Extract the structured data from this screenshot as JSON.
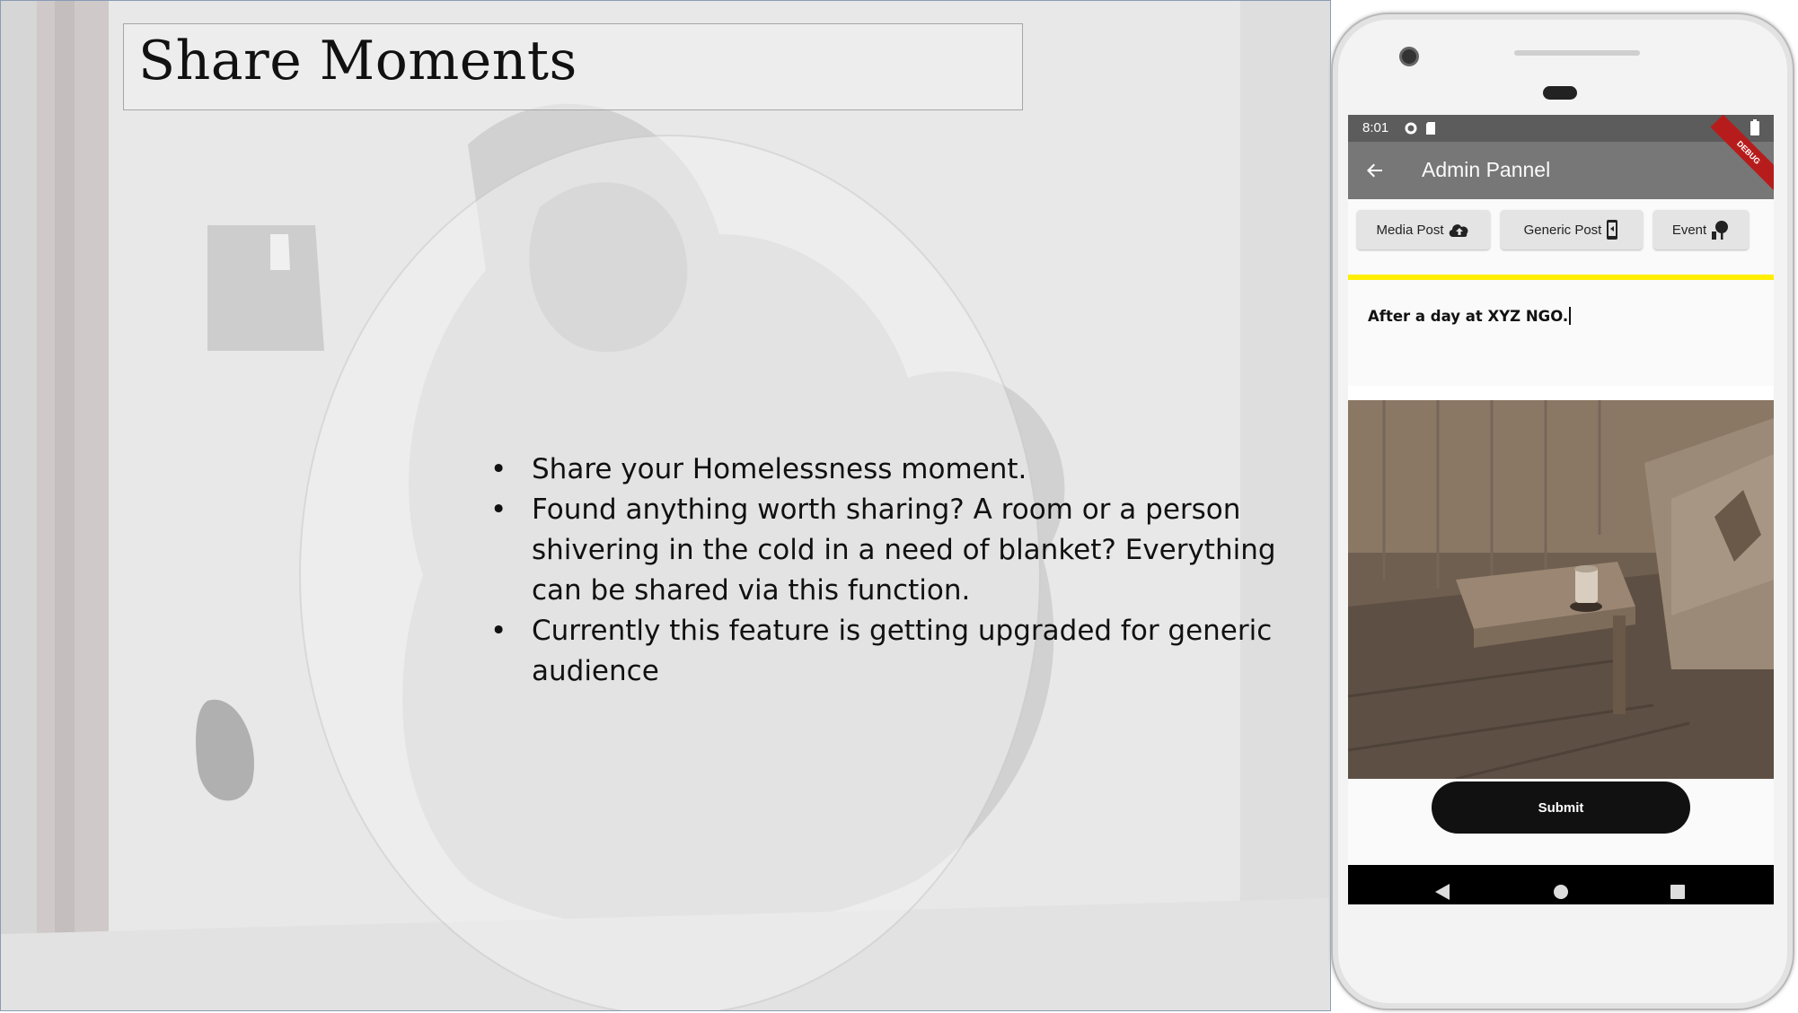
{
  "slide": {
    "title": "Share Moments",
    "bullets": [
      "Share your Homelessness moment.",
      "Found anything worth sharing? A room or a person shivering in the cold in a need of blanket? Everything can be shared via this function.",
      "Currently this feature is getting upgraded for generic audience"
    ]
  },
  "phone": {
    "status_bar": {
      "time": "8:01",
      "icons": [
        "gear-icon",
        "sd-card-icon",
        "wifi-icon",
        "battery-icon"
      ]
    },
    "app_bar": {
      "title": "Admin Pannel",
      "back_icon": "arrow-back-icon",
      "debug_label": "DEBUG"
    },
    "tabs": [
      {
        "label": "Media Post",
        "icon": "cloud-upload-icon"
      },
      {
        "label": "Generic Post",
        "icon": "phone-icon"
      },
      {
        "label": "Event",
        "icon": "tree-icon"
      }
    ],
    "caption": {
      "value": "After a day at XYZ NGO."
    },
    "submit_label": "Submit",
    "nav_icons": [
      "back-triangle-icon",
      "home-circle-icon",
      "recents-square-icon"
    ]
  },
  "colors": {
    "accent_yellow": "#ffee00",
    "app_bar": "#777777",
    "status_bar": "#5c5c5c",
    "submit_button": "#111111"
  }
}
